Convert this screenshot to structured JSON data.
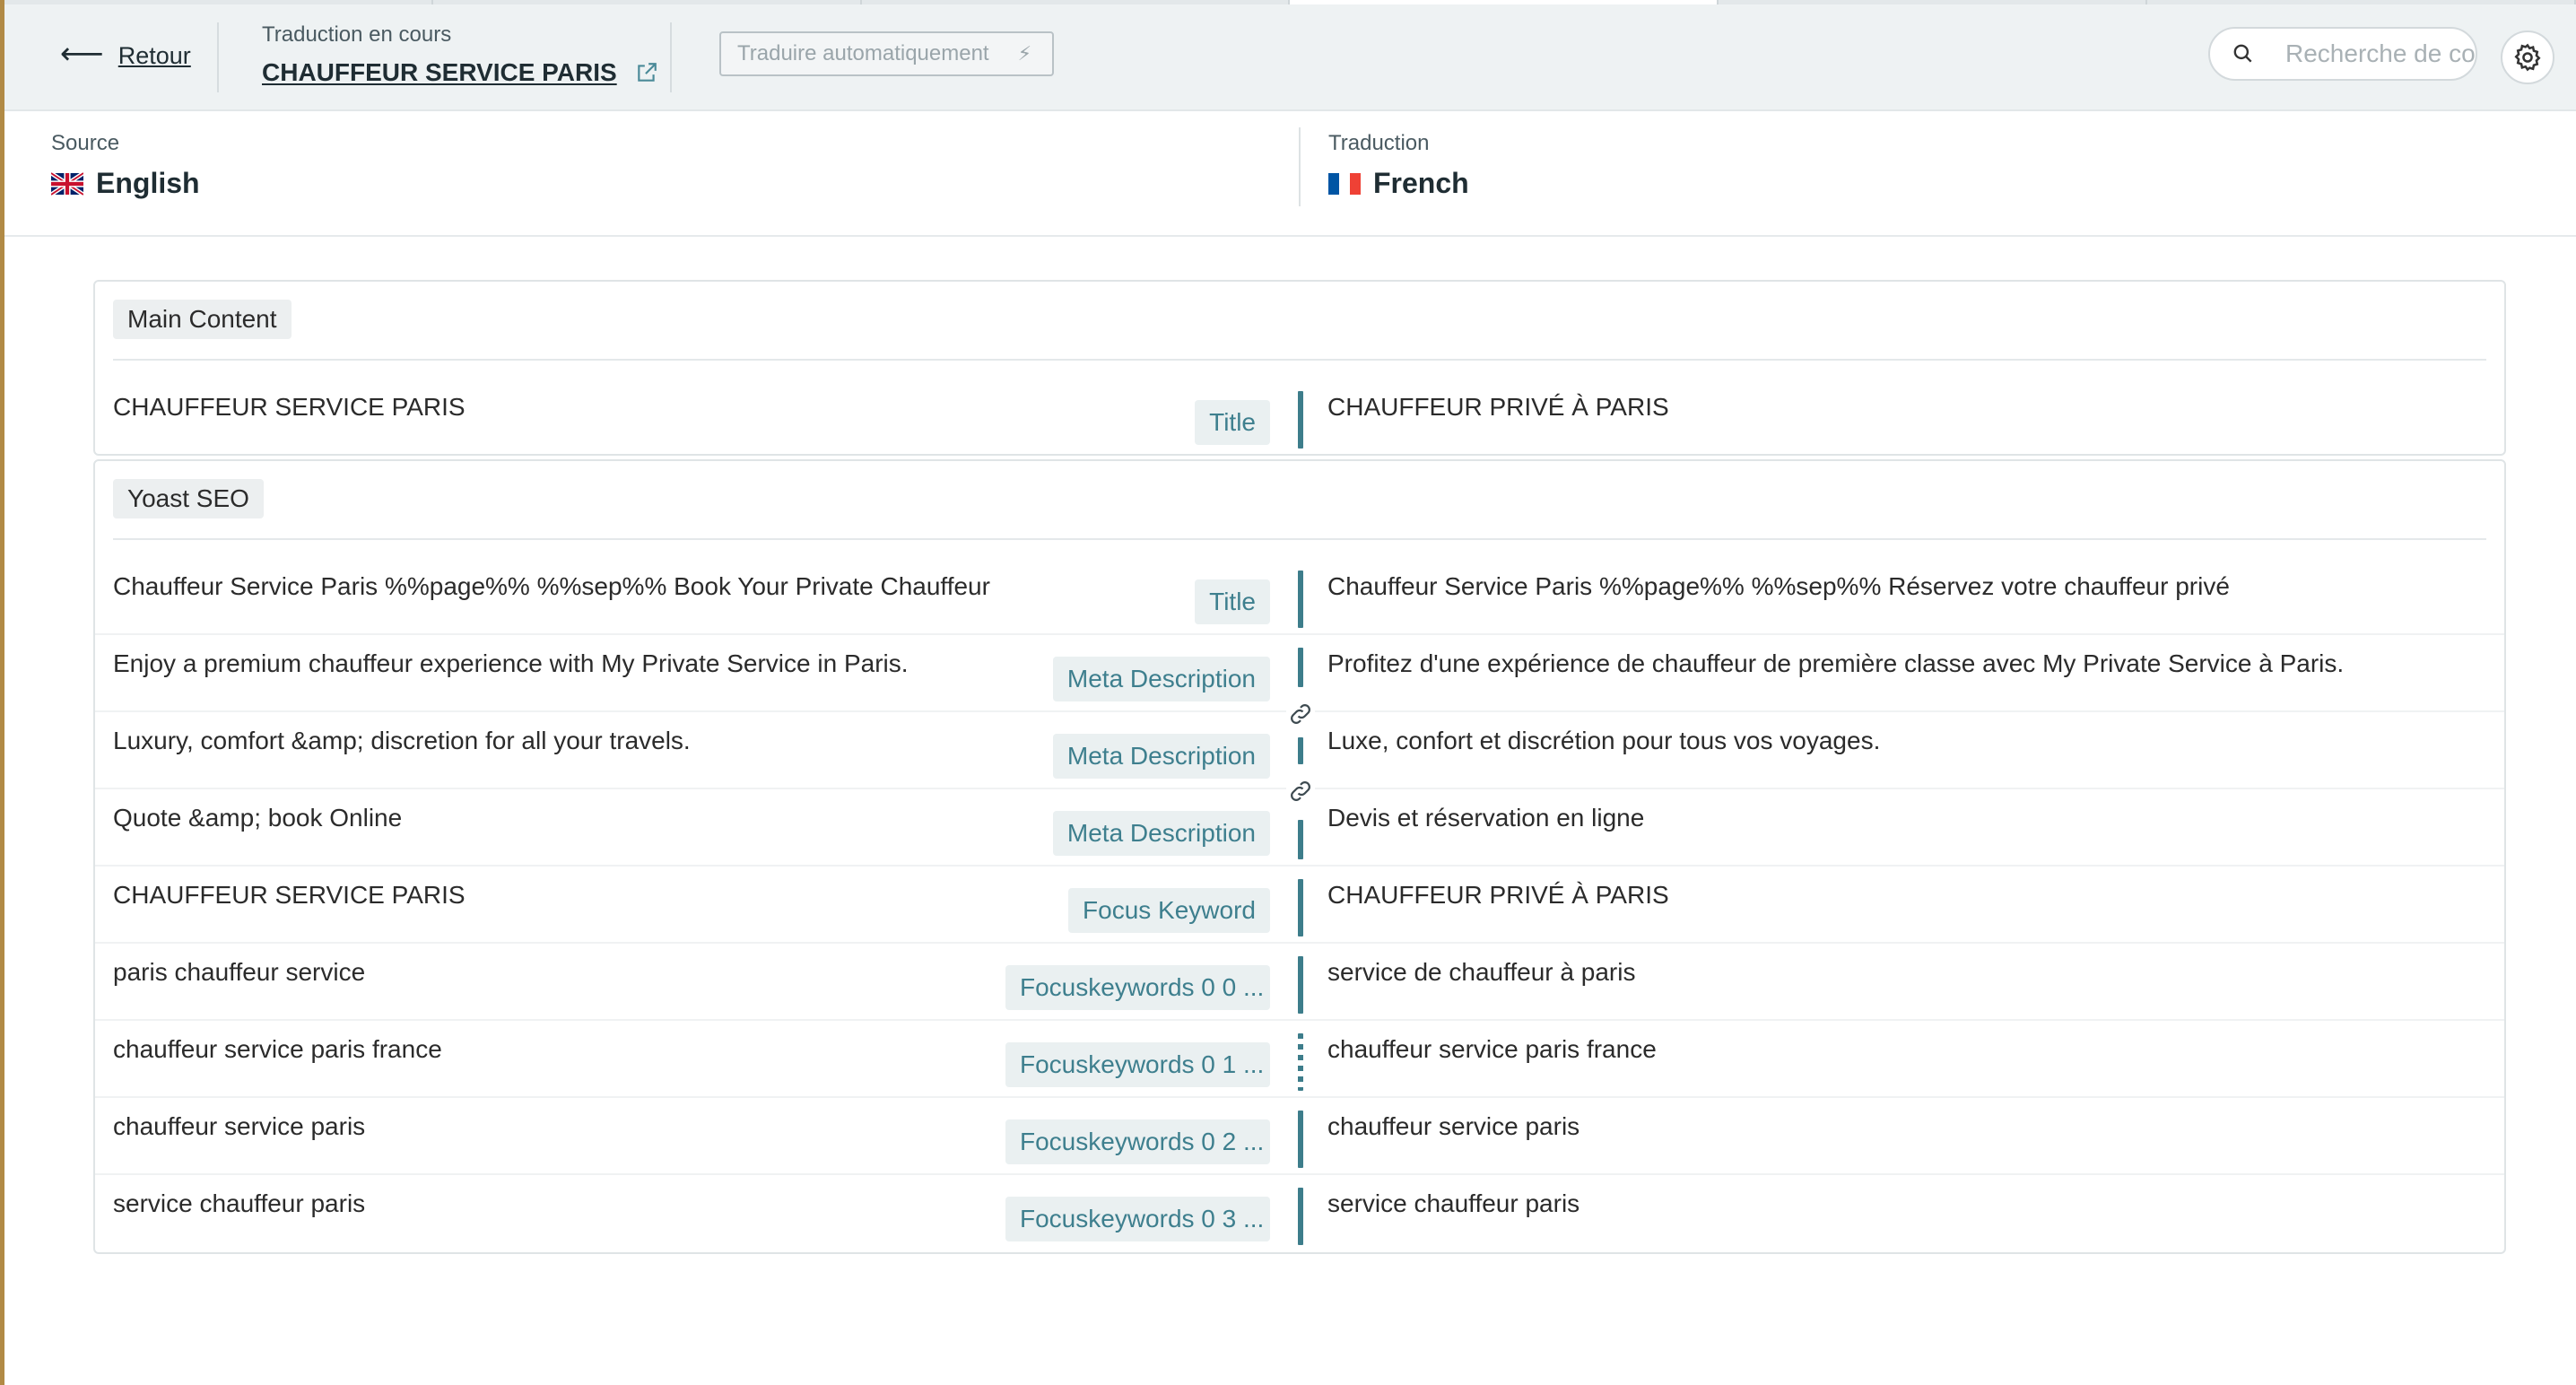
{
  "header": {
    "back_label": "Retour",
    "translation_caption": "Traduction en cours",
    "translation_title": "CHAUFFEUR SERVICE PARIS",
    "auto_translate_label": "Traduire automatiquement",
    "search_placeholder": "Recherche de co"
  },
  "languages": {
    "source_caption": "Source",
    "source_name": "English",
    "target_caption": "Traduction",
    "target_name": "French"
  },
  "sections": {
    "main": {
      "title": "Main Content",
      "rows": [
        {
          "source": "CHAUFFEUR SERVICE PARIS",
          "tag": "Title",
          "target": "CHAUFFEUR PRIVÉ À PARIS"
        }
      ]
    },
    "yoast": {
      "title": "Yoast SEO",
      "rows": [
        {
          "source": "Chauffeur Service Paris %%page%% %%sep%% Book Your Private Chauffeur",
          "tag": "Title",
          "target": "Chauffeur Service Paris %%page%% %%sep%% Réservez votre chauffeur privé"
        },
        {
          "source": "Enjoy a premium chauffeur experience with My Private Service in Paris.",
          "tag": "Meta Description",
          "target": "Profitez d'une expérience de chauffeur de première classe avec My Private Service à Paris."
        },
        {
          "source": "Luxury, comfort &amp; discretion for all your travels.",
          "tag": "Meta Description",
          "target": "Luxe, confort et discrétion pour tous vos voyages."
        },
        {
          "source": "Quote &amp; book Online",
          "tag": "Meta Description",
          "target": "Devis et réservation en ligne"
        },
        {
          "source": "CHAUFFEUR SERVICE PARIS",
          "tag": "Focus Keyword",
          "target": "CHAUFFEUR PRIVÉ À PARIS"
        },
        {
          "source": "paris chauffeur service",
          "tag": "Focuskeywords 0 0 ...",
          "target": "service de chauffeur à paris"
        },
        {
          "source": "chauffeur service paris france",
          "tag": "Focuskeywords 0 1 ...",
          "target": "chauffeur service paris france"
        },
        {
          "source": "chauffeur service paris",
          "tag": "Focuskeywords 0 2 ...",
          "target": "chauffeur service paris"
        },
        {
          "source": "service chauffeur paris",
          "tag": "Focuskeywords 0 3 ...",
          "target": "service chauffeur paris"
        }
      ]
    }
  },
  "colors": {
    "accent": "#3d7d8b",
    "tag_text": "#3e7f8e",
    "header_bg": "#eef2f3"
  }
}
